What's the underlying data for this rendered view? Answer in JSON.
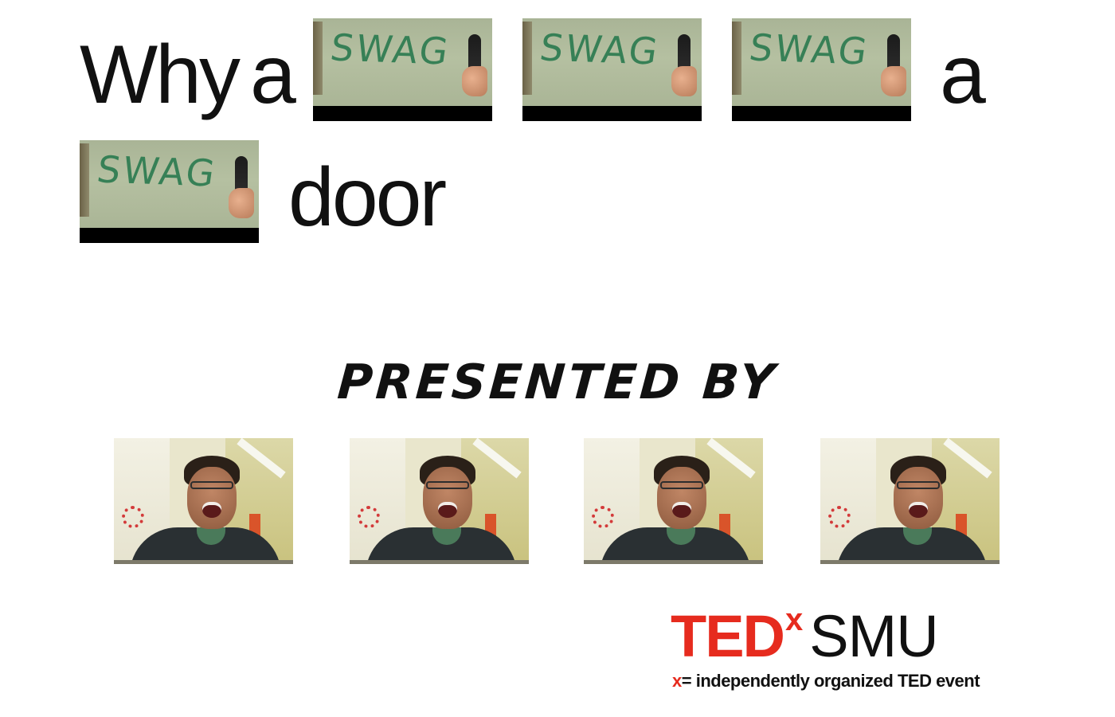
{
  "slide": {
    "title": {
      "word_why": "Why",
      "word_a1": "a",
      "word_a2": "a",
      "word_door": "door"
    },
    "swag_image_text": "SWAG",
    "presented_by": "PRESENTED BY",
    "presenter_photos_count": 4,
    "logo": {
      "ted": "TED",
      "x": "x",
      "smu": "SMU",
      "tagline_x": "x",
      "tagline_rest": "= independently organized TED event"
    },
    "colors": {
      "ted_red": "#e62b1e",
      "text": "#111111",
      "background": "#ffffff"
    }
  }
}
